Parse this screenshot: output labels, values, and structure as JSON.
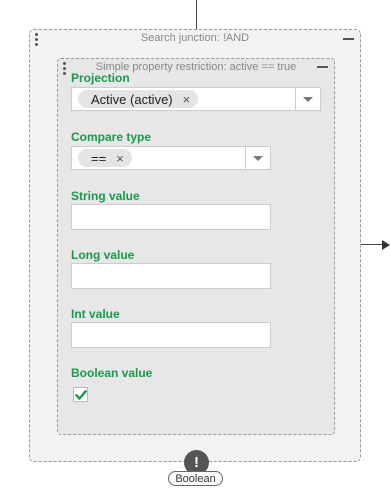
{
  "junction": {
    "title": "Search junction: !AND"
  },
  "restriction": {
    "title": "Simple property restriction: active == true",
    "projection": {
      "label": "Projection",
      "chip": "Active (active)",
      "chip_remove": "×"
    },
    "compare_type": {
      "label": "Compare type",
      "chip": "==",
      "chip_remove": "×"
    },
    "string_value": {
      "label": "String value",
      "value": ""
    },
    "long_value": {
      "label": "Long value",
      "value": ""
    },
    "int_value": {
      "label": "Int value",
      "value": ""
    },
    "boolean_value": {
      "label": "Boolean value",
      "checked": true,
      "check_color": "#1a9a4a"
    }
  },
  "output": {
    "badge": "!",
    "type_label": "Boolean"
  }
}
